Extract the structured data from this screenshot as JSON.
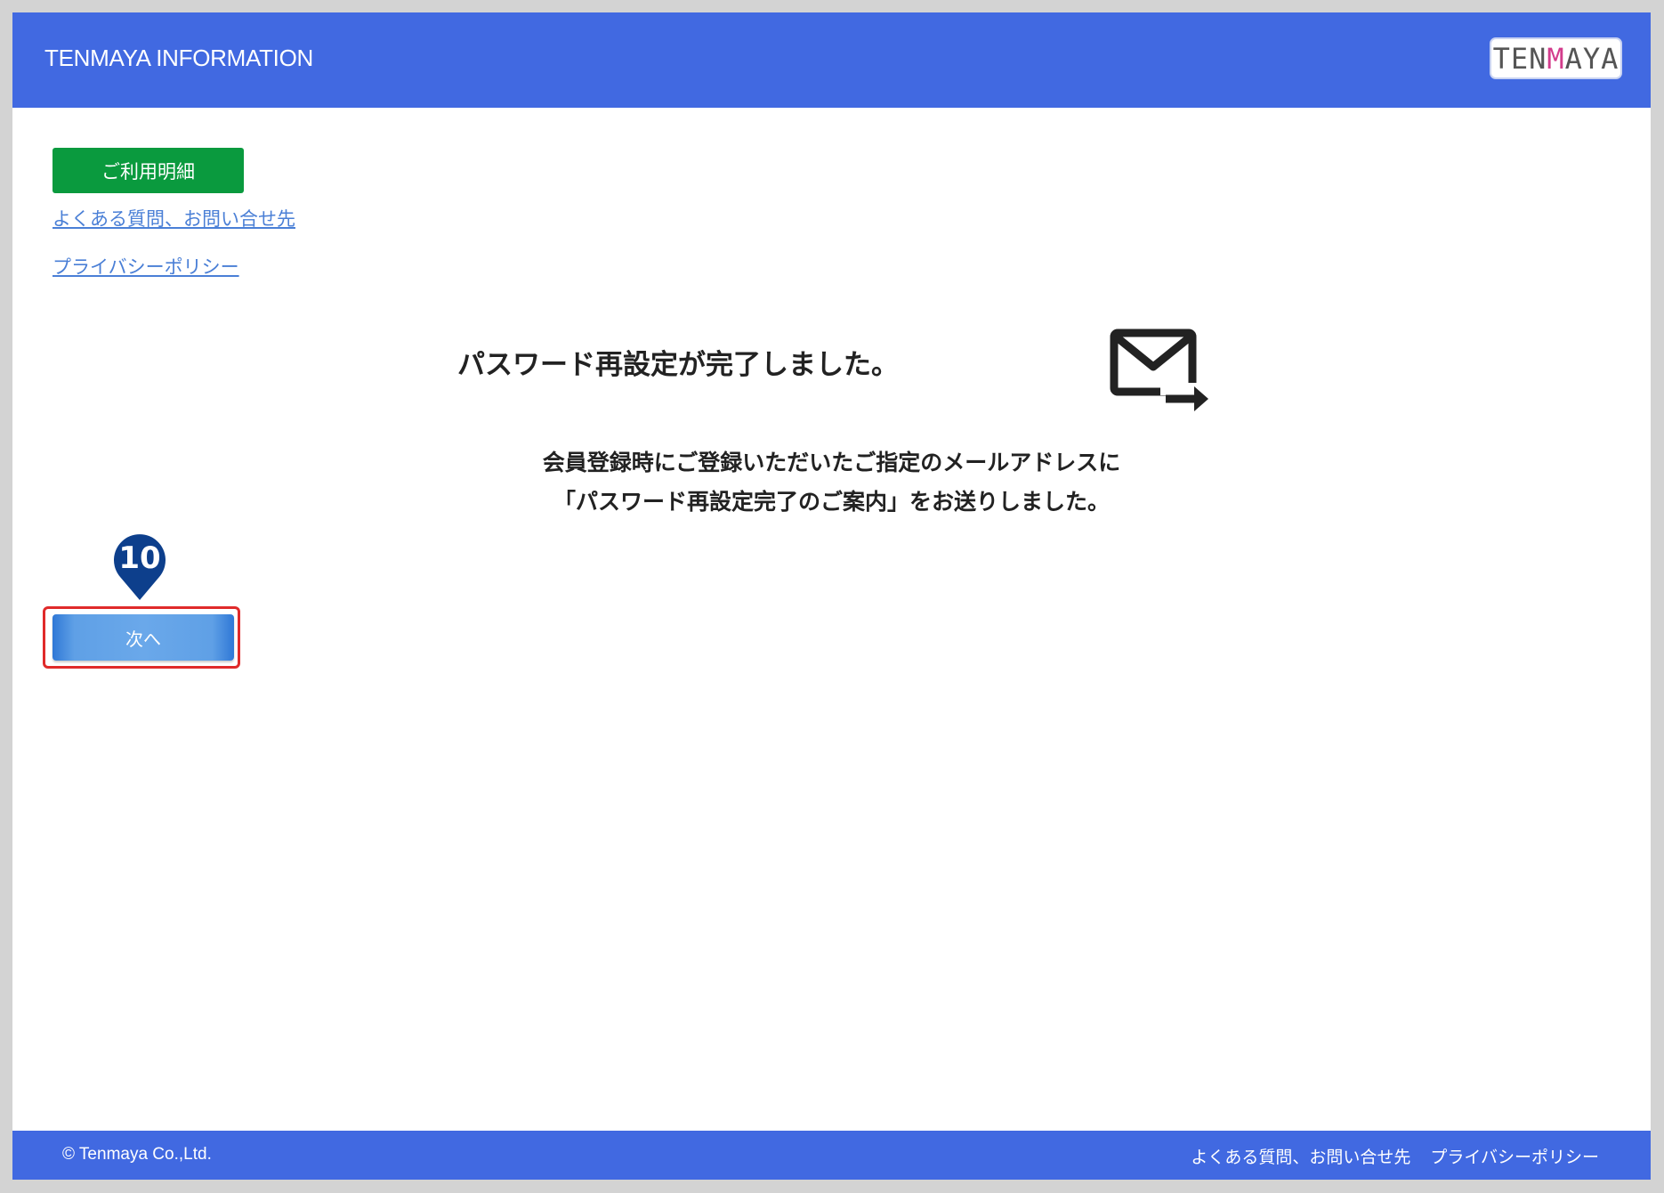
{
  "header": {
    "site_title": "TENMAYA INFORMATION",
    "logo_text_pre": "TEN",
    "logo_text_accent": "M",
    "logo_text_post": "AYA",
    "background_color": "#4169e1"
  },
  "sidebar": {
    "usage_button_label": "ご利用明細",
    "faq_link_label": "よくある質問、お問い合せ先",
    "privacy_link_label": "プライバシーポリシー"
  },
  "main": {
    "title": "パスワード再設定が完了しました。",
    "message_line1": "会員登録時にご登録いただいたご指定のメールアドレスに",
    "message_line2": "「パスワード再設定完了のご案内」をお送りしました。",
    "icon": "mail-send-icon"
  },
  "step_marker": {
    "number": "10",
    "color": "#0d3f8c"
  },
  "next_button": {
    "label": "次へ",
    "highlight_color": "#e02a2a"
  },
  "footer": {
    "copyright": "© Tenmaya Co.,Ltd.",
    "faq_link_label": "よくある質問、お問い合せ先",
    "privacy_link_label": "プライバシーポリシー"
  }
}
